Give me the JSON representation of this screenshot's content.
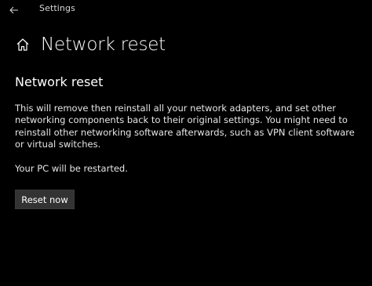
{
  "window": {
    "title": "Settings"
  },
  "header": {
    "title": "Network reset",
    "home_icon": "home-icon",
    "back_icon": "back-arrow-icon"
  },
  "section": {
    "title": "Network reset",
    "description": "This will remove then reinstall all your network adapters, and set other networking components back to their original settings. You might need to reinstall other networking software afterwards, such as VPN client software or virtual switches.",
    "restart_note": "Your PC will be restarted.",
    "button_label": "Reset now"
  },
  "colors": {
    "background": "#000000",
    "text": "#ffffff",
    "button_bg": "#333333"
  }
}
